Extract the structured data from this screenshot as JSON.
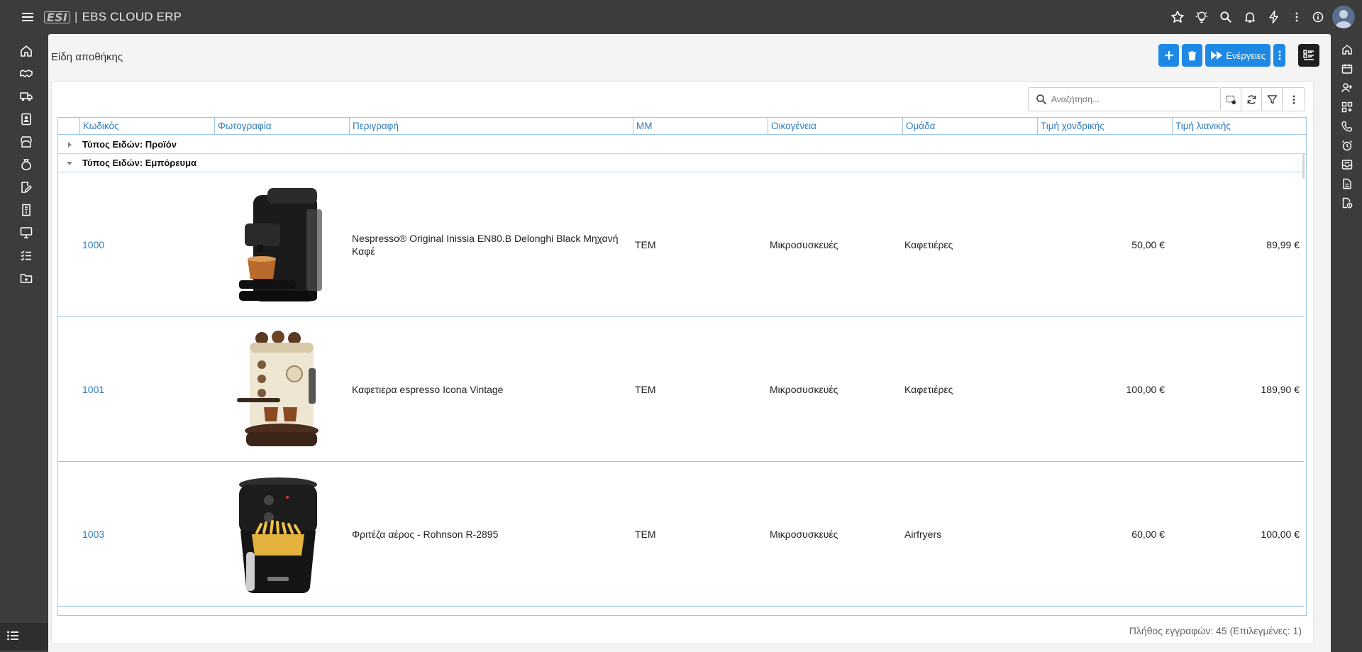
{
  "app": {
    "logo_text": "ESI",
    "separator": "|",
    "title": "EBS CLOUD ERP"
  },
  "page": {
    "title": "Είδη αποθήκης"
  },
  "toolbar": {
    "actions_label": "Ενέργειες"
  },
  "search": {
    "placeholder": "Αναζήτηση..."
  },
  "grid": {
    "columns": [
      "Κωδικός",
      "Φωτογραφία",
      "Περιγραφή",
      "ΜΜ",
      "Οικογένεια",
      "Ομάδα",
      "Τιμή χονδρικής",
      "Τιμή λιανικής"
    ],
    "groups": [
      {
        "label": "Τύπος Ειδών: Προϊόν",
        "expanded": false
      },
      {
        "label": "Τύπος Ειδών: Εμπόρευμα",
        "expanded": true
      }
    ],
    "rows": [
      {
        "code": "1000",
        "photo": "coffee-machine-black",
        "description": "Nespresso® Original Inissia EN80.B Delonghi Black Μηχανή Καφέ",
        "unit": "TEM",
        "family": "Μικροσυσκευές",
        "group": "Καφετιέρες",
        "wholesale": "50,00 €",
        "retail": "89,99 €"
      },
      {
        "code": "1001",
        "photo": "espresso-machine-cream",
        "description": "Καφετιερα espresso Icona Vintage",
        "unit": "TEM",
        "family": "Μικροσυσκευές",
        "group": "Καφετιέρες",
        "wholesale": "100,00 €",
        "retail": "189,90 €"
      },
      {
        "code": "1003",
        "photo": "air-fryer-black",
        "description": "Φριτέζα αέρος - Rohnson R-2895",
        "unit": "TEM",
        "family": "Μικροσυσκευές",
        "group": "Airfryers",
        "wholesale": "60,00 €",
        "retail": "100,00 €"
      }
    ]
  },
  "footer": {
    "records": "Πλήθος εγγραφών: 45 (Επιλεγμένες: 1)"
  },
  "colors": {
    "accent": "#1e88e5",
    "link": "#2f7cc0",
    "grid_border": "#9fc6e8",
    "topbar": "#3c3c3c"
  },
  "icons": {
    "top": [
      "star-icon",
      "lightbulb-icon",
      "search-icon",
      "bell-icon",
      "bolt-icon",
      "more-vert-icon",
      "info-icon",
      "avatar"
    ],
    "left": [
      "home-icon",
      "handshake-icon",
      "truck-icon",
      "contacts-icon",
      "store-icon",
      "money-bag-icon",
      "edit-doc-icon",
      "invoice-icon",
      "monitor-icon",
      "checklist-icon",
      "folder-icon",
      "list-icon",
      "gear-icon"
    ],
    "right": [
      "home-icon",
      "calendar-icon",
      "add-user-icon",
      "apps-icon",
      "phone-icon",
      "alarm-icon",
      "inbox-icon",
      "document-icon",
      "file-clock-icon"
    ]
  }
}
